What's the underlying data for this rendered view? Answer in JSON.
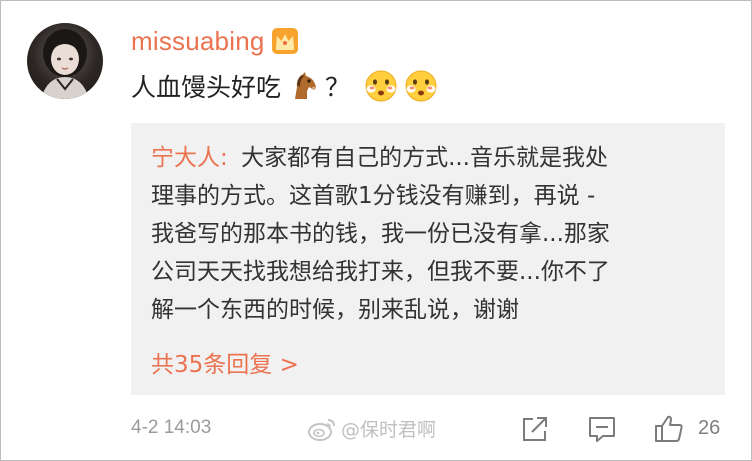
{
  "comment": {
    "username": "missuabing",
    "text": "人血馒头好吃",
    "question_mark": "？",
    "icons": [
      "crown-badge-icon",
      "horse-emoji-icon",
      "blush-face-emoji-icon",
      "blush-face-emoji-icon"
    ]
  },
  "reply": {
    "author": "宁大人:",
    "lines": [
      "大家都有自己的方式...音乐就是我处",
      "理事的方式。这首歌1分钱没有赚到，再说 -",
      "我爸写的那本书的钱，我一份已没有拿...那家",
      "公司天天找我想给我打来，但我不要...你不了",
      "解一个东西的时候，别来乱说，谢谢"
    ],
    "more_label": "共35条回复 >"
  },
  "footer": {
    "timestamp": "4-2 14:03",
    "watermark": "@保时君啊",
    "like_count": "26",
    "icons": [
      "share-icon",
      "comment-icon",
      "like-icon"
    ]
  },
  "colors": {
    "accent": "#eb7350",
    "reply_bg": "#f1f1f1",
    "meta_text": "#9b9b9b"
  }
}
